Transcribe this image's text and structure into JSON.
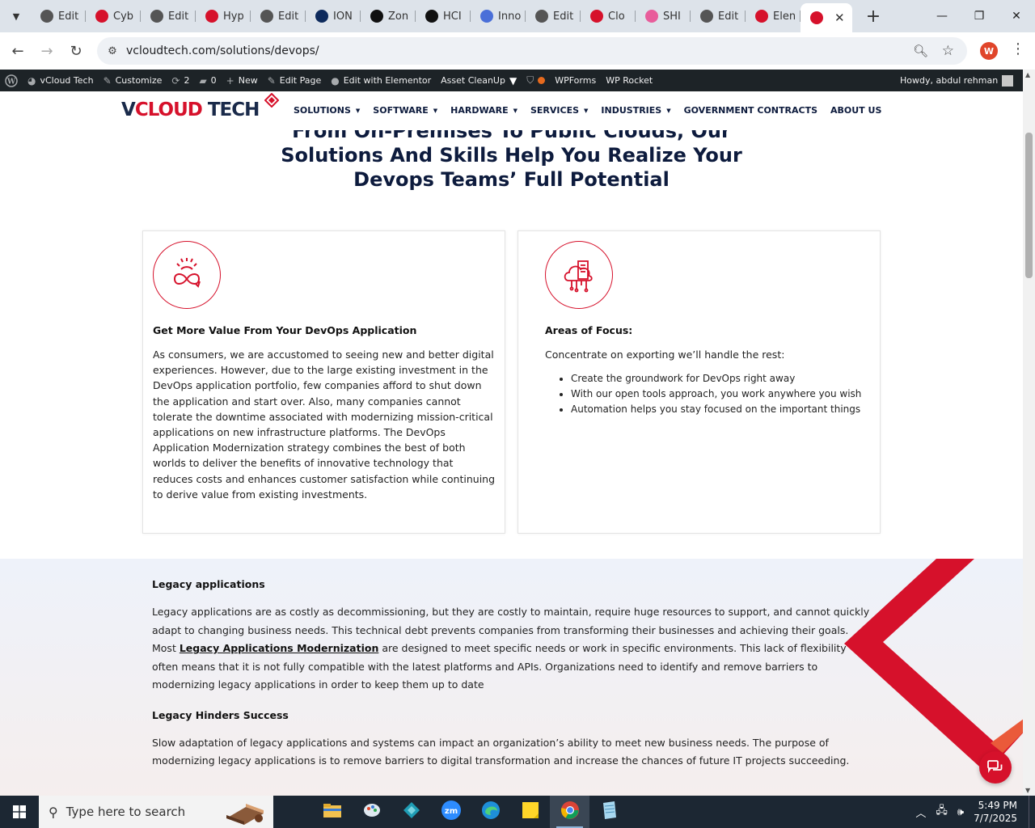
{
  "browser": {
    "tabs": [
      {
        "label": "Edit",
        "favicon": "wordpress-icon",
        "color": "#555"
      },
      {
        "label": "Cyb",
        "favicon": "elementor-diamond-icon",
        "color": "#d6112b"
      },
      {
        "label": "Edit",
        "favicon": "wordpress-icon",
        "color": "#555"
      },
      {
        "label": "Hyp",
        "favicon": "elementor-diamond-icon",
        "color": "#d6112b"
      },
      {
        "label": "Edit",
        "favicon": "wordpress-icon",
        "color": "#555"
      },
      {
        "label": "ION",
        "favicon": "n-logo-icon",
        "color": "#0d2a5c"
      },
      {
        "label": "Zon",
        "favicon": "z-logo-icon",
        "color": "#111"
      },
      {
        "label": "HCI",
        "favicon": "openai-icon",
        "color": "#111"
      },
      {
        "label": "Inno",
        "favicon": "feather-icon",
        "color": "#4a6fd8"
      },
      {
        "label": "Edit",
        "favicon": "wordpress-icon",
        "color": "#555"
      },
      {
        "label": "Clo",
        "favicon": "swoosh-icon",
        "color": "#d6112b"
      },
      {
        "label": "SHI",
        "favicon": "ring-icon",
        "color": "#e85d9b"
      },
      {
        "label": "Edit",
        "favicon": "wordpress-icon",
        "color": "#555"
      },
      {
        "label": "Elen",
        "favicon": "elementor-diamond-icon",
        "color": "#d6112b"
      }
    ],
    "active_tab_close": "✕",
    "url": "vcloudtech.com/solutions/devops/",
    "profile_initial": "W"
  },
  "adminbar": {
    "site": "vCloud Tech",
    "customize": "Customize",
    "updates": "2",
    "comments": "0",
    "new": "New",
    "edit_page": "Edit Page",
    "edit_elementor": "Edit with Elementor",
    "asset_cleanup": "Asset CleanUp",
    "wpforms": "WPForms",
    "wp_rocket": "WP Rocket",
    "howdy": "Howdy, abdul rehman"
  },
  "site": {
    "logo_v": "V",
    "logo_cloud": "CLOUD ",
    "logo_tech": "TECH",
    "nav": [
      {
        "label": "SOLUTIONS",
        "caret": true
      },
      {
        "label": "SOFTWARE",
        "caret": true
      },
      {
        "label": "HARDWARE",
        "caret": true
      },
      {
        "label": "SERVICES",
        "caret": true
      },
      {
        "label": "INDUSTRIES",
        "caret": true
      },
      {
        "label": "GOVERNMENT CONTRACTS",
        "caret": false
      },
      {
        "label": "ABOUT US",
        "caret": false
      }
    ],
    "accent": "#d6112b",
    "navy": "#0d1b3d"
  },
  "hero": {
    "line1": "From On-Premises To Public Clouds, Our",
    "line2": "Solutions And Skills Help You Realize Your",
    "line3": "Devops Teams’ Full Potential"
  },
  "card1": {
    "icon": "gear-infinity-icon",
    "title": "Get More Value From Your DevOps Application",
    "body": "As consumers, we are accustomed to seeing new and better digital experiences. However, due to the large existing investment in the DevOps application portfolio, few companies afford to shut down the application and start over. Also, many companies cannot tolerate the downtime associated with modernizing mission-critical applications on new infrastructure platforms. The DevOps Application Modernization strategy combines the best of both worlds to deliver the benefits of innovative technology that reduces costs and enhances customer satisfaction while continuing to derive value from existing investments."
  },
  "card2": {
    "icon": "cloud-server-icon",
    "title": "Areas of Focus:",
    "intro": "Concentrate on exporting we’ll handle the rest:",
    "bullets": [
      "Create the groundwork for DevOps right away",
      "With our open tools approach, you work anywhere you wish",
      "Automation helps you stay focused on the important things"
    ]
  },
  "legacy": {
    "h1": "Legacy applications",
    "p1_a": "Legacy applications are as costly as decommissioning, but they are costly to maintain, require huge resources to support, and cannot quickly adapt to changing business needs. This technical debt prevents companies from transforming their businesses and achieving their goals. Most ",
    "p1_link": "Legacy Applications Modernization",
    "p1_b": " are designed to meet specific needs or work in specific environments. This lack of flexibility often means that it is not fully compatible with the latest platforms and APIs. Organizations need to identify and remove barriers to modernizing legacy applications in order to keep them up to date",
    "h2": "Legacy Hinders Success",
    "p2": "Slow adaptation of legacy applications and systems can impact an organization’s ability to meet new business needs. The purpose of modernizing legacy applications is to remove barriers to digital transformation and increase the chances of future IT projects succeeding."
  },
  "taskbar": {
    "search_placeholder": "Type here to search",
    "apps": [
      "file-explorer-icon",
      "paint-icon",
      "app-diamond-icon",
      "zoom-icon",
      "edge-icon",
      "sticky-notes-icon",
      "chrome-icon",
      "notepad-icon"
    ],
    "time": "5:49 PM",
    "date": "7/7/2025"
  }
}
